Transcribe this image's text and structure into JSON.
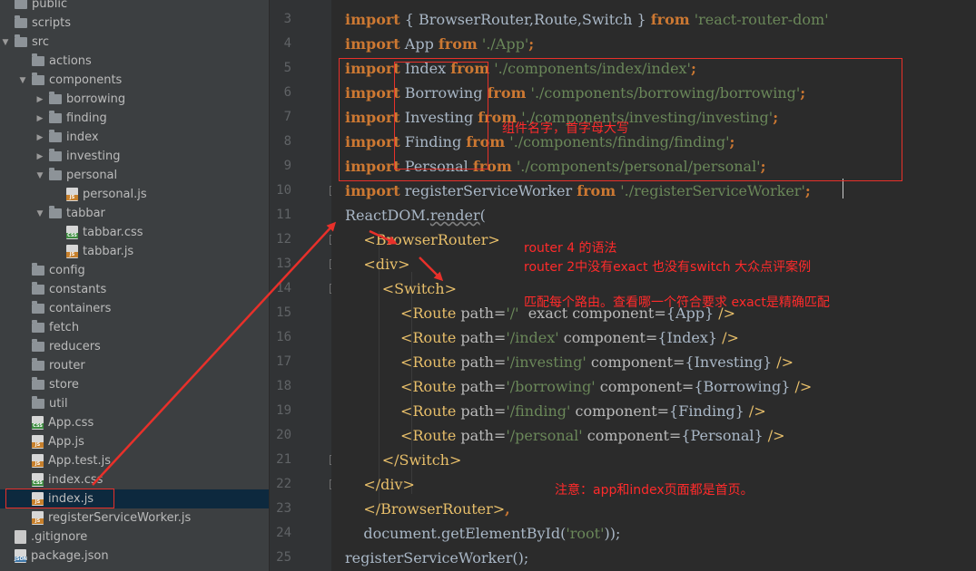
{
  "sidebar": {
    "items": [
      {
        "label": "public",
        "type": "folder",
        "depth": 0,
        "arrow": ""
      },
      {
        "label": "scripts",
        "type": "folder",
        "depth": 0,
        "arrow": ""
      },
      {
        "label": "src",
        "type": "folder",
        "depth": 0,
        "arrow": "▼"
      },
      {
        "label": "actions",
        "type": "folder",
        "depth": 1,
        "arrow": ""
      },
      {
        "label": "components",
        "type": "folder",
        "depth": 1,
        "arrow": "▼"
      },
      {
        "label": "borrowing",
        "type": "folder",
        "depth": 2,
        "arrow": "▶"
      },
      {
        "label": "finding",
        "type": "folder",
        "depth": 2,
        "arrow": "▶"
      },
      {
        "label": "index",
        "type": "folder",
        "depth": 2,
        "arrow": "▶"
      },
      {
        "label": "investing",
        "type": "folder",
        "depth": 2,
        "arrow": "▶"
      },
      {
        "label": "personal",
        "type": "folder",
        "depth": 2,
        "arrow": "▼"
      },
      {
        "label": "personal.js",
        "type": "js",
        "depth": 3,
        "arrow": ""
      },
      {
        "label": "tabbar",
        "type": "folder",
        "depth": 2,
        "arrow": "▼"
      },
      {
        "label": "tabbar.css",
        "type": "css",
        "depth": 3,
        "arrow": ""
      },
      {
        "label": "tabbar.js",
        "type": "js",
        "depth": 3,
        "arrow": ""
      },
      {
        "label": "config",
        "type": "folder",
        "depth": 1,
        "arrow": ""
      },
      {
        "label": "constants",
        "type": "folder",
        "depth": 1,
        "arrow": ""
      },
      {
        "label": "containers",
        "type": "folder",
        "depth": 1,
        "arrow": ""
      },
      {
        "label": "fetch",
        "type": "folder",
        "depth": 1,
        "arrow": ""
      },
      {
        "label": "reducers",
        "type": "folder",
        "depth": 1,
        "arrow": ""
      },
      {
        "label": "router",
        "type": "folder",
        "depth": 1,
        "arrow": ""
      },
      {
        "label": "store",
        "type": "folder",
        "depth": 1,
        "arrow": ""
      },
      {
        "label": "util",
        "type": "folder",
        "depth": 1,
        "arrow": ""
      },
      {
        "label": "App.css",
        "type": "css",
        "depth": 1,
        "arrow": ""
      },
      {
        "label": "App.js",
        "type": "js",
        "depth": 1,
        "arrow": ""
      },
      {
        "label": "App.test.js",
        "type": "js",
        "depth": 1,
        "arrow": ""
      },
      {
        "label": "index.css",
        "type": "css",
        "depth": 1,
        "arrow": ""
      },
      {
        "label": "index.js",
        "type": "js",
        "depth": 1,
        "arrow": "",
        "selected": true
      },
      {
        "label": "registerServiceWorker.js",
        "type": "js",
        "depth": 1,
        "arrow": ""
      },
      {
        "label": ".gitignore",
        "type": "plain",
        "depth": 0,
        "arrow": ""
      },
      {
        "label": "package.json",
        "type": "json",
        "depth": 0,
        "arrow": ""
      }
    ],
    "icon_tags": {
      "js": "JS",
      "css": "CSS",
      "json": "JSON"
    }
  },
  "editor": {
    "line_numbers": [
      3,
      4,
      5,
      6,
      7,
      8,
      9,
      10,
      11,
      12,
      13,
      14,
      15,
      16,
      17,
      18,
      19,
      20,
      21,
      22,
      23,
      24,
      25
    ],
    "lines": [
      [
        {
          "t": "import",
          "c": "kw"
        },
        {
          "t": " { BrowserRouter,Route,Switch } ",
          "c": "plain"
        },
        {
          "t": "from",
          "c": "kw"
        },
        {
          "t": " 'react-router-dom'",
          "c": "str"
        }
      ],
      [
        {
          "t": "import",
          "c": "kw"
        },
        {
          "t": " App ",
          "c": "plain"
        },
        {
          "t": "from",
          "c": "kw"
        },
        {
          "t": " './App'",
          "c": "str"
        },
        {
          "t": ";",
          "c": "kw"
        }
      ],
      [
        {
          "t": "import",
          "c": "kw"
        },
        {
          "t": " Index ",
          "c": "plain"
        },
        {
          "t": "from",
          "c": "kw"
        },
        {
          "t": " './components/index/index'",
          "c": "str"
        },
        {
          "t": ";",
          "c": "kw"
        }
      ],
      [
        {
          "t": "import",
          "c": "kw"
        },
        {
          "t": " Borrowing ",
          "c": "plain"
        },
        {
          "t": "from",
          "c": "kw"
        },
        {
          "t": " './components/borrowing/borrowing'",
          "c": "str"
        },
        {
          "t": ";",
          "c": "kw"
        }
      ],
      [
        {
          "t": "import",
          "c": "kw"
        },
        {
          "t": " Investing ",
          "c": "plain"
        },
        {
          "t": "from",
          "c": "kw"
        },
        {
          "t": " './components/investing/investing'",
          "c": "str"
        },
        {
          "t": ";",
          "c": "kw"
        }
      ],
      [
        {
          "t": "import",
          "c": "kw"
        },
        {
          "t": " Finding ",
          "c": "plain"
        },
        {
          "t": "from",
          "c": "kw"
        },
        {
          "t": " './components/finding/finding'",
          "c": "str"
        },
        {
          "t": ";",
          "c": "kw"
        }
      ],
      [
        {
          "t": "import",
          "c": "kw"
        },
        {
          "t": " Personal ",
          "c": "plain"
        },
        {
          "t": "from",
          "c": "kw"
        },
        {
          "t": " './components/personal/personal'",
          "c": "str"
        },
        {
          "t": ";",
          "c": "kw"
        }
      ],
      [
        {
          "t": "import",
          "c": "kw"
        },
        {
          "t": " registerServiceWorker ",
          "c": "plain"
        },
        {
          "t": "from",
          "c": "kw"
        },
        {
          "t": " './registerServiceWorker'",
          "c": "str"
        },
        {
          "t": ";",
          "c": "kw"
        }
      ],
      [
        {
          "t": "ReactDOM.",
          "c": "plain"
        },
        {
          "t": "render",
          "c": "plain squiggle"
        },
        {
          "t": "(",
          "c": "plain"
        }
      ],
      [
        {
          "t": "    <BrowserRouter>",
          "c": "tag"
        }
      ],
      [
        {
          "t": "    <div>",
          "c": "tag"
        }
      ],
      [
        {
          "t": "        <Switch>",
          "c": "tag"
        }
      ],
      [
        {
          "t": "            <Route ",
          "c": "tag"
        },
        {
          "t": "path=",
          "c": "attr"
        },
        {
          "t": "'/' ",
          "c": "str"
        },
        {
          "t": " exact ",
          "c": "attr"
        },
        {
          "t": "component=",
          "c": "attr"
        },
        {
          "t": "{App}",
          "c": "plain"
        },
        {
          "t": " />",
          "c": "tag"
        }
      ],
      [
        {
          "t": "            <Route ",
          "c": "tag"
        },
        {
          "t": "path=",
          "c": "attr"
        },
        {
          "t": "'/index' ",
          "c": "str"
        },
        {
          "t": "component=",
          "c": "attr"
        },
        {
          "t": "{Index}",
          "c": "plain"
        },
        {
          "t": " />",
          "c": "tag"
        }
      ],
      [
        {
          "t": "            <Route ",
          "c": "tag"
        },
        {
          "t": "path=",
          "c": "attr"
        },
        {
          "t": "'/investing' ",
          "c": "str"
        },
        {
          "t": "component=",
          "c": "attr"
        },
        {
          "t": "{Investing}",
          "c": "plain"
        },
        {
          "t": " />",
          "c": "tag"
        }
      ],
      [
        {
          "t": "            <Route ",
          "c": "tag"
        },
        {
          "t": "path=",
          "c": "attr"
        },
        {
          "t": "'/borrowing' ",
          "c": "str"
        },
        {
          "t": "component=",
          "c": "attr"
        },
        {
          "t": "{Borrowing}",
          "c": "plain"
        },
        {
          "t": " />",
          "c": "tag"
        }
      ],
      [
        {
          "t": "            <Route ",
          "c": "tag"
        },
        {
          "t": "path=",
          "c": "attr"
        },
        {
          "t": "'/finding' ",
          "c": "str"
        },
        {
          "t": "component=",
          "c": "attr"
        },
        {
          "t": "{Finding}",
          "c": "plain"
        },
        {
          "t": " />",
          "c": "tag"
        }
      ],
      [
        {
          "t": "            <Route ",
          "c": "tag"
        },
        {
          "t": "path=",
          "c": "attr"
        },
        {
          "t": "'/personal' ",
          "c": "str"
        },
        {
          "t": "component=",
          "c": "attr"
        },
        {
          "t": "{Personal}",
          "c": "plain"
        },
        {
          "t": " />",
          "c": "tag"
        }
      ],
      [
        {
          "t": "        </Switch>",
          "c": "tag"
        }
      ],
      [
        {
          "t": "    </div>",
          "c": "tag"
        }
      ],
      [
        {
          "t": "    </BrowserRouter>",
          "c": "tag"
        },
        {
          "t": ",",
          "c": "kw"
        }
      ],
      [
        {
          "t": "    document.",
          "c": "plain"
        },
        {
          "t": "getElementById",
          "c": "plain"
        },
        {
          "t": "(",
          "c": "plain"
        },
        {
          "t": "'root'",
          "c": "str"
        },
        {
          "t": "));",
          "c": "plain"
        }
      ],
      [
        {
          "t": "registerServiceWorker",
          "c": "plain"
        },
        {
          "t": "();",
          "c": "plain"
        }
      ]
    ]
  },
  "annotations": {
    "component_note": "组件名字，首字母大写",
    "router4_note": "router 4 的语法",
    "router2_note": "router 2中没有exact 也没有switch  大众点评案例",
    "match_note": "匹配每个路由。查看哪一个符合要求  exact是精确匹配",
    "home_note": "注意：app和index页面都是首页。",
    "color": "#ff2b2b"
  }
}
